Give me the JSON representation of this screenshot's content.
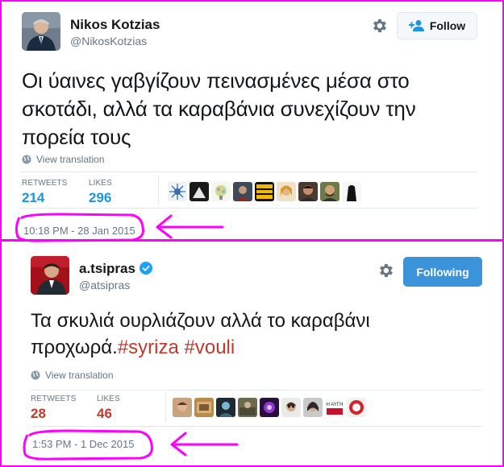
{
  "tweets": [
    {
      "name": "Nikos Kotzias",
      "handle": "@NikosKotzias",
      "button_label": "Follow",
      "text": "Οι ύαινες γαβγίζουν πεινασμένες  μέσα στο σκοτάδι, αλλά τα καραβάνια συνεχίζουν την πορεία τους",
      "view_translation": "View translation",
      "retweets_label": "RETWEETS",
      "retweets": "214",
      "likes_label": "LIKES",
      "likes": "296",
      "timestamp": "10:18 PM - 28 Jan 2015"
    },
    {
      "name": "a.tsipras",
      "verified": true,
      "handle": "@atsipras",
      "button_label": "Following",
      "text_main": "Τα σκυλιά ουρλιάζουν αλλά το καραβάνι προχωρά.",
      "hashtag1": "#syriza",
      "hashtag2": "#vouli",
      "view_translation": "View translation",
      "retweets_label": "RETWEETS",
      "retweets": "28",
      "likes_label": "LIKES",
      "likes": "46",
      "timestamp": "1:53 PM - 1 Dec 2015",
      "liker_caption": "Η ΑΥΓΗ"
    }
  ],
  "colors": {
    "annotation": "#ff00ff",
    "link_blue": "#1b95e0",
    "count_red": "#c0392b",
    "following_blue": "#3b94d9"
  },
  "icons": [
    "gear-icon",
    "follow-person-plus-icon",
    "globe-icon",
    "verified-badge-icon",
    "arrow-annotation-icon"
  ]
}
